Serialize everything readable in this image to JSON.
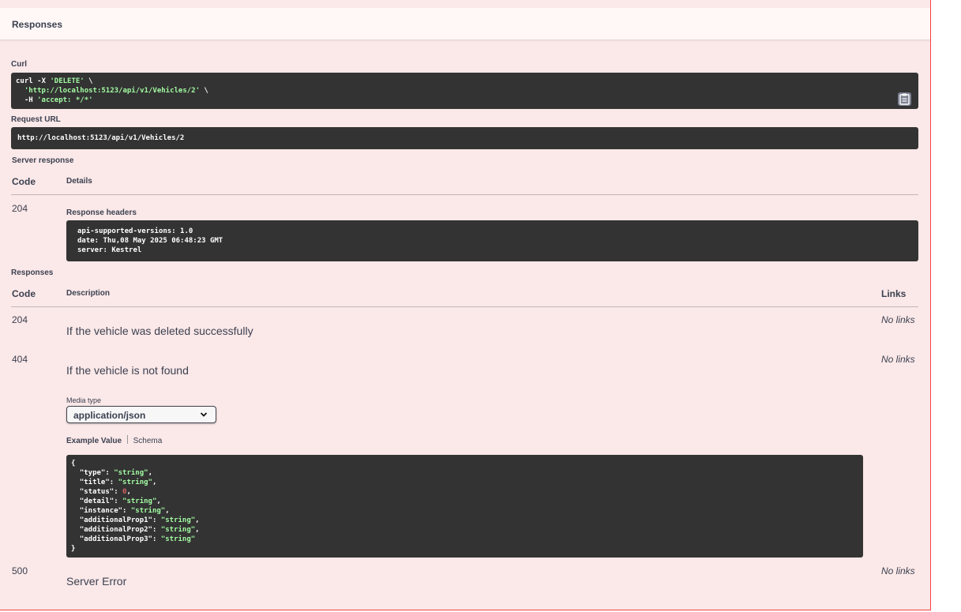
{
  "responses_header": {
    "title": "Responses"
  },
  "curl": {
    "label": "Curl",
    "line1_cmd": "curl -X ",
    "line1_method": "'DELETE'",
    "line1_tail": " \\",
    "line2_url": "'http://localhost:5123/api/v1/Vehicles/2'",
    "line2_tail": " \\",
    "line3_flag": "-H ",
    "line3_header": "'accept: */*'",
    "copy_icon": "clipboard-icon"
  },
  "request_url": {
    "label": "Request URL",
    "value": "http://localhost:5123/api/v1/Vehicles/2"
  },
  "server_response": {
    "label": "Server response",
    "col_code": "Code",
    "col_details": "Details",
    "code": "204",
    "headers_label": "Response headers",
    "headers": [
      "api-supported-versions: 1.0",
      "date: Thu,08 May 2025 06:48:23 GMT",
      "server: Kestrel"
    ]
  },
  "responses": {
    "label": "Responses",
    "col_code": "Code",
    "col_description": "Description",
    "col_links": "Links",
    "rows": [
      {
        "code": "204",
        "description": "If the vehicle was deleted successfully",
        "links": "No links"
      },
      {
        "code": "404",
        "description": "If the vehicle is not found",
        "links": "No links"
      },
      {
        "code": "500",
        "description": "Server Error",
        "links": "No links"
      }
    ],
    "media_type_label": "Media type",
    "media_type_value": "application/json",
    "example_tab": "Example Value",
    "schema_tab": "Schema",
    "example": {
      "open": "{",
      "close": "}",
      "fields": [
        {
          "key": "\"type\"",
          "value": "\"string\"",
          "kind": "str",
          "sep": ","
        },
        {
          "key": "\"title\"",
          "value": "\"string\"",
          "kind": "str",
          "sep": ","
        },
        {
          "key": "\"status\"",
          "value": "0",
          "kind": "num",
          "sep": ","
        },
        {
          "key": "\"detail\"",
          "value": "\"string\"",
          "kind": "str",
          "sep": ","
        },
        {
          "key": "\"instance\"",
          "value": "\"string\"",
          "kind": "str",
          "sep": ","
        },
        {
          "key": "\"additionalProp1\"",
          "value": "\"string\"",
          "kind": "str",
          "sep": ","
        },
        {
          "key": "\"additionalProp2\"",
          "value": "\"string\"",
          "kind": "str",
          "sep": ","
        },
        {
          "key": "\"additionalProp3\"",
          "value": "\"string\"",
          "kind": "str",
          "sep": ""
        }
      ]
    }
  }
}
